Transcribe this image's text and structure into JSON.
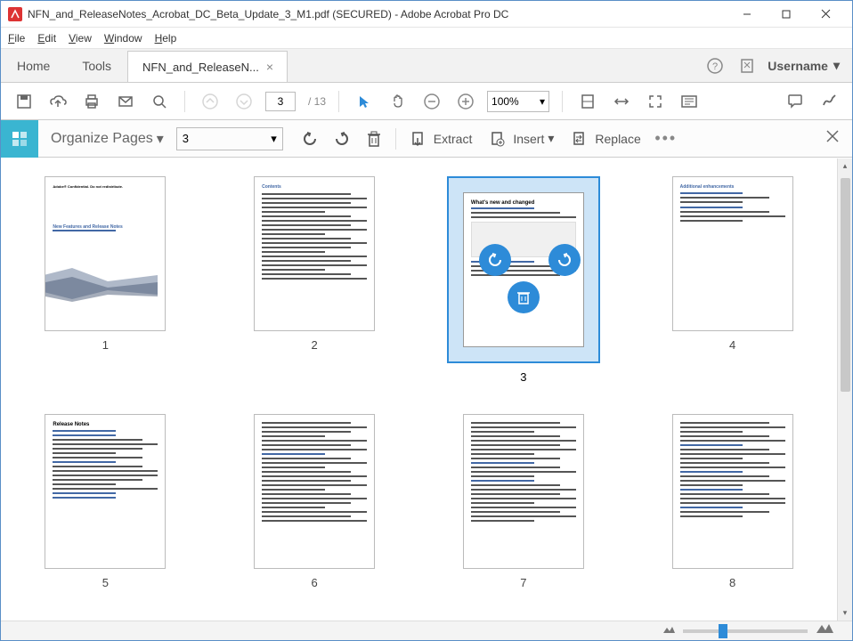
{
  "window": {
    "title": "NFN_and_ReleaseNotes_Acrobat_DC_Beta_Update_3_M1.pdf (SECURED) - Adobe Acrobat Pro DC"
  },
  "menu": {
    "file": "File",
    "edit": "Edit",
    "view": "View",
    "window": "Window",
    "help": "Help"
  },
  "tabs": {
    "home": "Home",
    "tools": "Tools",
    "doc": "NFN_and_ReleaseN...",
    "username": "Username"
  },
  "toolbar": {
    "page_current": "3",
    "page_total": "/ 13",
    "zoom": "100%"
  },
  "organize": {
    "title": "Organize Pages",
    "page_sel": "3",
    "extract": "Extract",
    "insert": "Insert",
    "replace": "Replace"
  },
  "pages": {
    "p1": "1",
    "p2": "2",
    "p3": "3",
    "p4": "4",
    "p5": "5",
    "p6": "6",
    "p7": "7",
    "p8": "8",
    "p3_heading": "What's new and changed",
    "p4_heading": "Additional enhancements",
    "p5_heading": "Release Notes",
    "p2_heading": "Contents",
    "p1_line1": "Adobe® Confidential. Do not redistribute.",
    "p1_line2": "New Features and Release Notes"
  }
}
